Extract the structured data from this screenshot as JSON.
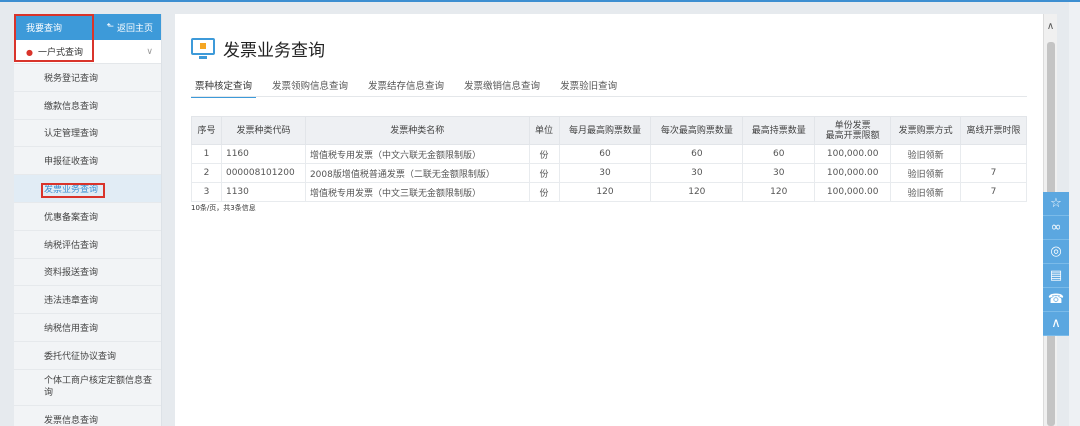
{
  "sidebar": {
    "title": "我要查询",
    "back_label": "返回主页",
    "group_label": "一户式查询",
    "items": [
      {
        "label": "税务登记查询"
      },
      {
        "label": "缴款信息查询"
      },
      {
        "label": "认定管理查询"
      },
      {
        "label": "申报征收查询"
      },
      {
        "label": "发票业务查询"
      },
      {
        "label": "优惠备案查询"
      },
      {
        "label": "纳税评估查询"
      },
      {
        "label": "资料报送查询"
      },
      {
        "label": "违法违章查询"
      },
      {
        "label": "纳税信用查询"
      },
      {
        "label": "委托代征协议查询"
      },
      {
        "label": "个体工商户核定定额信息查询"
      },
      {
        "label": "发票信息查询"
      }
    ]
  },
  "main": {
    "title": "发票业务查询",
    "tabs": [
      {
        "label": "票种核定查询"
      },
      {
        "label": "发票领购信息查询"
      },
      {
        "label": "发票结存信息查询"
      },
      {
        "label": "发票缴销信息查询"
      },
      {
        "label": "发票验旧查询"
      }
    ]
  },
  "table": {
    "headers": {
      "seq": "序号",
      "code": "发票种类代码",
      "name": "发票种类名称",
      "unit": "单位",
      "monthly_max": "每月最高购票数量",
      "each_max": "每次最高购票数量",
      "max_hold": "最高持票数量",
      "limit_line1": "单份发票",
      "limit_line2": "最高开票限额",
      "method": "发票购票方式",
      "offline": "离线开票时限"
    },
    "rows": [
      {
        "seq": "1",
        "code": "1160",
        "name": "增值税专用发票（中文六联无金额限制版）",
        "unit": "份",
        "monthly_max": "60",
        "each_max": "60",
        "max_hold": "60",
        "limit": "100,000.00",
        "method": "验旧领新",
        "offline": ""
      },
      {
        "seq": "2",
        "code": "000008101200",
        "name": "2008版增值税普通发票（二联无金额限制版）",
        "unit": "份",
        "monthly_max": "30",
        "each_max": "30",
        "max_hold": "30",
        "limit": "100,000.00",
        "method": "验旧领新",
        "offline": "7"
      },
      {
        "seq": "3",
        "code": "1130",
        "name": "增值税专用发票（中文三联无金额限制版）",
        "unit": "份",
        "monthly_max": "120",
        "each_max": "120",
        "max_hold": "120",
        "limit": "100,000.00",
        "method": "验旧领新",
        "offline": "7"
      }
    ],
    "summary": "10条/页，共3条信息"
  },
  "float_toolbar": {
    "icons": [
      "star-icon",
      "link-icon",
      "weibo-icon",
      "clipboard-icon",
      "phone-icon",
      "chevron-up-icon"
    ]
  },
  "colors": {
    "accent": "#3d9ad9",
    "highlight": "#d9342b"
  }
}
